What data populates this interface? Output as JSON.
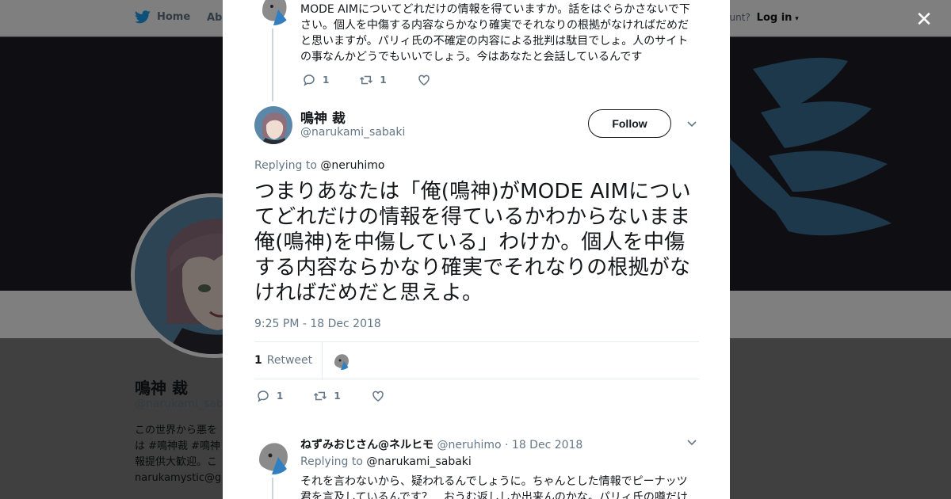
{
  "colors": {
    "twitter_blue": "#1da1f2",
    "text": "#14171a",
    "muted": "#657786",
    "border": "#e6ecf0"
  },
  "topbar": {
    "home_label": "Home",
    "about_label": "Abo",
    "account_prompt": "ccount?",
    "login_label": "Log in"
  },
  "profile": {
    "name": "鳴神 裁",
    "handle": "@narukami_saba",
    "bio": "この世界から悪を は #鳴神裁 #鳴神 報提供大歓迎。こ narukamystic@gr"
  },
  "modal": {
    "close_icon": "close-icon",
    "previous_tweet": {
      "text": "MODE AIMについてどれだけの情報を得ていますか。話をはぐらかさないで下さい。個人を中傷する内容ならかなり確実でそれなりの根拠がなければだめだと思いますが。パリィ氏の不確定の内容による批判は駄目でしょ。人のサイトの事なんかどうでもいいでしょう。今はあなたと会話しているんです",
      "replies": "1",
      "retweets": "1"
    },
    "main_tweet": {
      "author_name": "鳴神 裁",
      "author_handle": "@narukami_sabaki",
      "follow_label": "Follow",
      "replying_prefix": "Replying to",
      "replying_to": "@neruhimo",
      "text": "つまりあなたは「俺(鳴神)がMODE AIMについてどれだけの情報を得ているかわからないまま俺(鳴神)を中傷している」わけか。個人を中傷する内容ならかなり確実でそれなりの根拠がなければだめだと思えよ。",
      "timestamp": "9:25 PM - 18 Dec 2018",
      "retweet_count": "1",
      "retweet_label": "Retweet",
      "replies": "1",
      "retweets": "1"
    },
    "reply_tweet": {
      "author_name": "ねずみおじさん@ネルヒモ",
      "author_handle": "@neruhimo",
      "date": "18 Dec 2018",
      "replying_prefix": "Replying to",
      "replying_to": "@narukami_sabaki",
      "text": "それを言わないから、疑われるんでしょうに。ちゃんとした情報でピーナッツ君を言及しているんです？　おうむ返ししか出来んのかな。パリィ氏の噂だけ"
    }
  }
}
